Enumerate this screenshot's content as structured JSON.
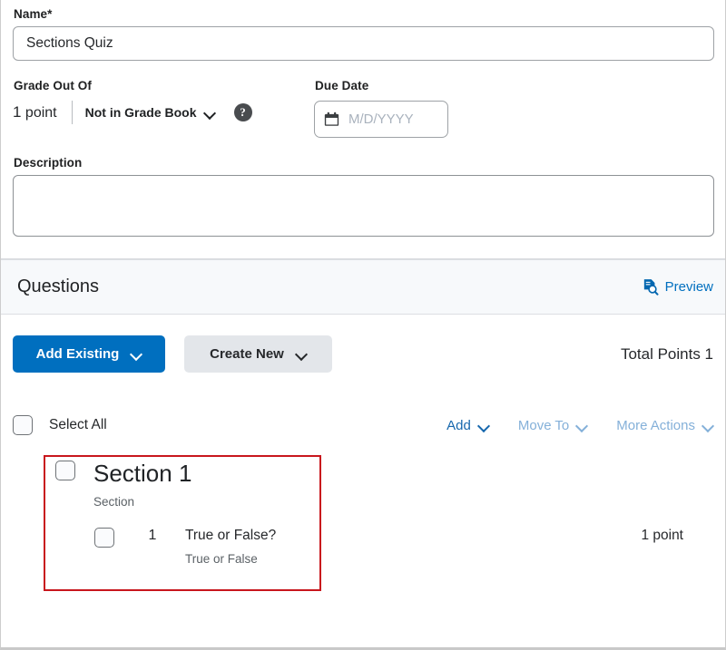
{
  "form": {
    "name": {
      "label": "Name",
      "required_marker": "*",
      "value": "Sections Quiz"
    },
    "grade_out_of": {
      "label": "Grade Out Of",
      "points_number": "1",
      "points_unit": "point",
      "gradebook_option": "Not in Grade Book",
      "help_glyph": "?",
      "chevron_icon": "chevron-down-icon",
      "help_icon": "help-circle-icon"
    },
    "due_date": {
      "label": "Due Date",
      "placeholder": "M/D/YYYY",
      "calendar_icon": "calendar-icon"
    },
    "description": {
      "label": "Description",
      "value": ""
    }
  },
  "questions_section": {
    "title": "Questions",
    "preview": {
      "label": "Preview",
      "icon": "document-search-icon"
    },
    "buttons": {
      "add_existing": "Add Existing",
      "create_new": "Create New",
      "chevron_icon": "chevron-down-icon"
    },
    "total_points": "Total Points 1",
    "select_all": {
      "label": "Select All",
      "checkbox": "unchecked"
    },
    "actions": [
      {
        "label": "Add",
        "enabled": true,
        "icon": "chevron-down-icon"
      },
      {
        "label": "Move To",
        "enabled": false,
        "icon": "chevron-down-icon"
      },
      {
        "label": "More Actions",
        "enabled": false,
        "icon": "chevron-down-icon"
      }
    ],
    "items": [
      {
        "type_label": "Section",
        "title": "Section 1",
        "checkbox": "unchecked",
        "questions": [
          {
            "number": "1",
            "title": "True or False?",
            "type_label": "True or False",
            "points": "1 point",
            "checkbox": "unchecked"
          }
        ]
      }
    ]
  },
  "colors": {
    "accent_blue": "#006fbf",
    "link_blue": "#1667ad",
    "link_blue_disabled": "#84b0d9",
    "annotation_red": "#c8161d",
    "header_bg": "#f7f9fb"
  }
}
